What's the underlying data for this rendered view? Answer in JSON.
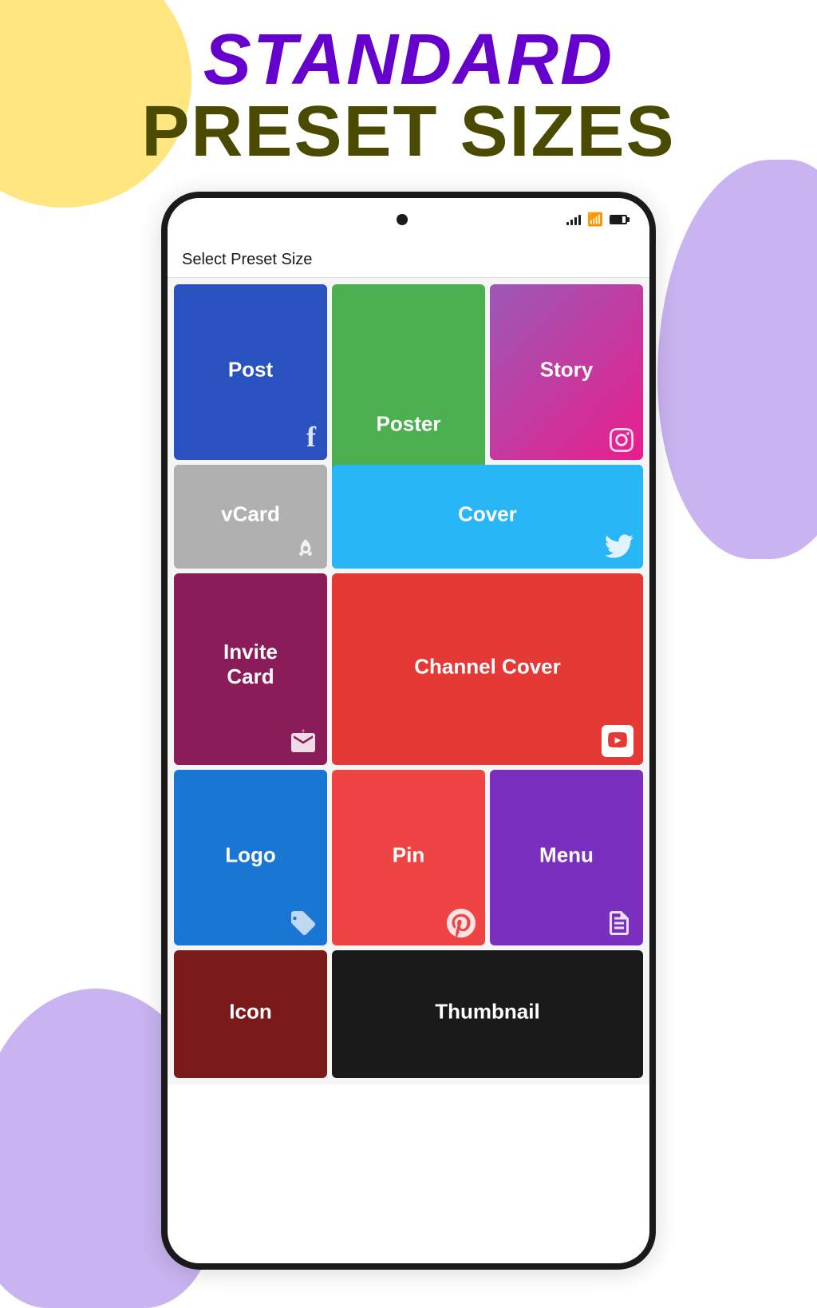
{
  "background": {
    "yellow_circle": "decorative",
    "purple_right": "decorative",
    "purple_bottom": "decorative"
  },
  "header": {
    "line1": "STANDARD",
    "line2": "PRESET SIZES"
  },
  "phone": {
    "screen_title": "Select Preset Size",
    "status": {
      "signal": "signal",
      "wifi": "wifi",
      "battery": "battery"
    }
  },
  "tiles": [
    {
      "id": "post",
      "label": "Post",
      "icon": "facebook-icon",
      "color": "#2A52BE",
      "gridCol": "1",
      "gridRow": "1"
    },
    {
      "id": "poster",
      "label": "Poster",
      "icon": "poster-icon",
      "color": "#4CAF50",
      "gridCol": "2",
      "gridRow": "1/3"
    },
    {
      "id": "story",
      "label": "Story",
      "icon": "instagram-icon",
      "color": "gradient-purple-pink",
      "gridCol": "3",
      "gridRow": "1"
    },
    {
      "id": "vcard",
      "label": "vCard",
      "icon": "rocket-icon",
      "color": "#B0B0B0",
      "gridCol": "1",
      "gridRow": "2"
    },
    {
      "id": "cover",
      "label": "Cover",
      "icon": "twitter-icon",
      "color": "#29B6F6",
      "gridCol": "2/4",
      "gridRow": "2"
    },
    {
      "id": "invite",
      "label": "Invite\nCard",
      "icon": "invite-icon",
      "color": "#8B1C5A",
      "gridCol": "1",
      "gridRow": "3"
    },
    {
      "id": "channel",
      "label": "Channel Cover",
      "icon": "youtube-icon",
      "color": "#E53935",
      "gridCol": "2/4",
      "gridRow": "3"
    },
    {
      "id": "logo",
      "label": "Logo",
      "icon": "logo-icon",
      "color": "#1976D2",
      "gridCol": "1",
      "gridRow": "4"
    },
    {
      "id": "pin",
      "label": "Pin",
      "icon": "pinterest-icon",
      "color": "#EF4444",
      "gridCol": "2",
      "gridRow": "4"
    },
    {
      "id": "menu",
      "label": "Menu",
      "icon": "menu-icon",
      "color": "#7B2FBE",
      "gridCol": "3",
      "gridRow": "4"
    },
    {
      "id": "icon",
      "label": "Icon",
      "icon": "none",
      "color": "#7B1A1A",
      "gridCol": "1",
      "gridRow": "5"
    },
    {
      "id": "thumbnail",
      "label": "Thumbnail",
      "icon": "none",
      "color": "#1a1a1a",
      "gridCol": "2/4",
      "gridRow": "5"
    }
  ]
}
